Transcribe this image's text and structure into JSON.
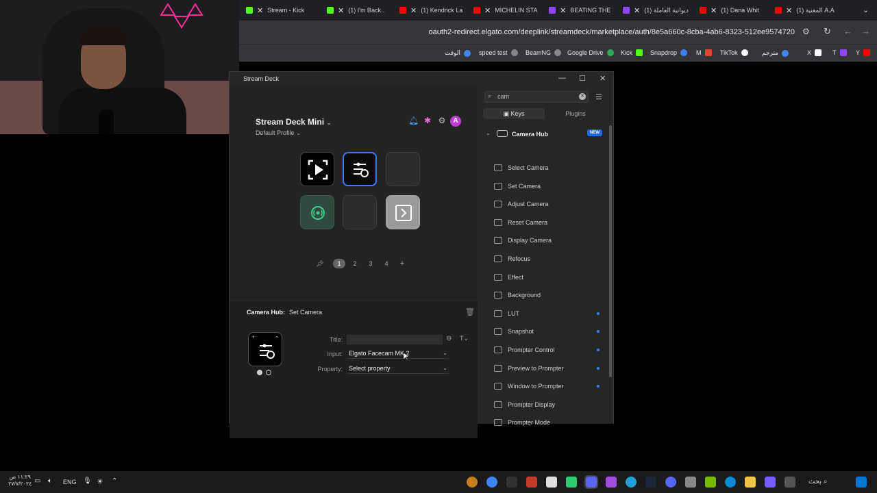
{
  "browser": {
    "tabs": [
      {
        "label": "Stream - Kick",
        "color": "#53fc18"
      },
      {
        "label": "(1) I'm Back..",
        "color": "#ff0000"
      },
      {
        "label": "(1) Kendrick La",
        "color": "#ff0000"
      },
      {
        "label": "MICHELIN STA",
        "color": "#9146ff"
      },
      {
        "label": "BEATING THE",
        "color": "#9146ff"
      },
      {
        "label": "(1) ديوانية العاملة",
        "color": "#ff0000"
      },
      {
        "label": "(1) Dana Whit",
        "color": "#ff0000"
      },
      {
        "label": "(1) المغنية A.A",
        "color": "#ff0000"
      }
    ],
    "url": "oauth2-redirect.elgato.com/deeplink/streamdeck/marketplace/auth/8e5a660c-8cba-4ab6-8323-512ee9574720",
    "bookmarks": [
      {
        "label": "الوقت",
        "color": "#4285f4"
      },
      {
        "label": "speed test",
        "color": "#888"
      },
      {
        "label": "BeamNG",
        "color": "#888"
      },
      {
        "label": "Google Drive",
        "color": "#34a853"
      },
      {
        "label": "Kick",
        "color": "#53fc18"
      },
      {
        "label": "Snapdrop",
        "color": "#3b82f6"
      },
      {
        "label": "M",
        "color": "#ea4335"
      },
      {
        "label": "TikTok",
        "color": "#fff"
      },
      {
        "label": "مترجم",
        "color": "#4285f4"
      },
      {
        "label": "X",
        "color": "#fff"
      },
      {
        "label": "T",
        "color": "#9146ff"
      },
      {
        "label": "Y",
        "color": "#ff0000"
      }
    ]
  },
  "app": {
    "window_title": "Stream Deck",
    "device_name": "Stream Deck Mini",
    "profile": "Default Profile",
    "avatar_letter": "A",
    "pages": [
      "1",
      "2",
      "3",
      "4"
    ],
    "active_page": "1",
    "inspector": {
      "plugin": "Camera Hub:",
      "action": "Set Camera",
      "title_label": "Title:",
      "title_value": "",
      "input_label": "Input:",
      "input_value": "Elgato Facecam MK.2",
      "property_label": "Property:",
      "property_value": "Select property"
    },
    "search": {
      "value": "cam"
    },
    "tabs": [
      "Keys",
      "Plugins"
    ],
    "active_tab": "Keys",
    "category": {
      "name": "Camera Hub",
      "badge": "NEW"
    },
    "actions": [
      {
        "label": "Select Camera",
        "dot": false
      },
      {
        "label": "Set Camera",
        "dot": false
      },
      {
        "label": "Adjust Camera",
        "dot": false
      },
      {
        "label": "Reset Camera",
        "dot": false
      },
      {
        "label": "Display Camera",
        "dot": false
      },
      {
        "label": "Refocus",
        "dot": false
      },
      {
        "label": "Effect",
        "dot": false
      },
      {
        "label": "Background",
        "dot": false
      },
      {
        "label": "LUT",
        "dot": true
      },
      {
        "label": "Snapshot",
        "dot": true
      },
      {
        "label": "Prompter Control",
        "dot": true
      },
      {
        "label": "Preview to Prompter",
        "dot": true
      },
      {
        "label": "Window to Prompter",
        "dot": true
      },
      {
        "label": "Prompter Display",
        "dot": false
      },
      {
        "label": "Prompter Mode",
        "dot": false
      }
    ]
  },
  "taskbar": {
    "language": "ENG",
    "time": "١١:٢٩ ص",
    "date": "٢٧/٧/٢٠٢٤",
    "search_label": "بحث"
  },
  "colors": {
    "accent": "#3a7bff",
    "avatar": "#c13dd6"
  }
}
